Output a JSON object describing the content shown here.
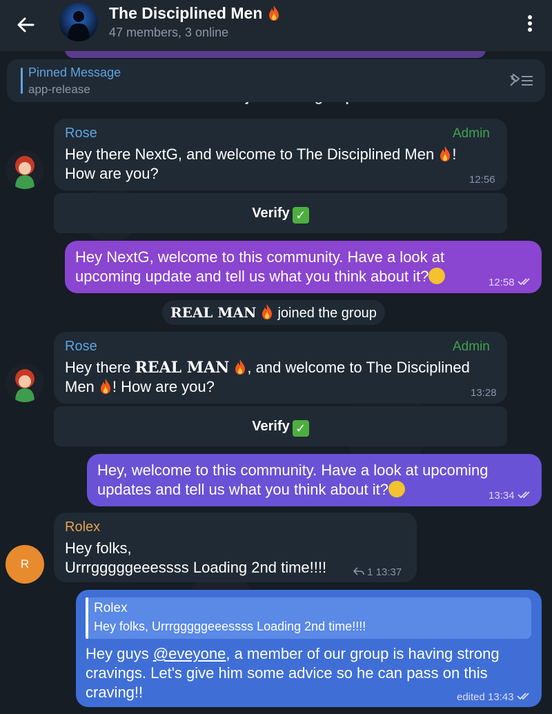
{
  "header": {
    "title": "The Disciplined Men",
    "subtitle": "47 members, 3 online"
  },
  "pinned": {
    "label": "Pinned Message",
    "text": "app-release"
  },
  "clipped_service": "NextG joined the group",
  "messages": [
    {
      "sender": "Rose",
      "role": "Admin",
      "line1": "Hey there NextG, and welcome to The Disciplined Men",
      "line1_end": "!",
      "line2": "How are you?",
      "time": "12:56",
      "button": "Verify"
    },
    {
      "line1": "Hey NextG, welcome to this community. Have a look at",
      "line2": "upcoming update and tell us what you think about it?",
      "time": "12:58"
    },
    {
      "service_name": "REAL MAN",
      "service_text": "joined the group"
    },
    {
      "sender": "Rose",
      "role": "Admin",
      "line1_a": "Hey there",
      "line1_name": "REAL MAN",
      "line1_b": ", and welcome to The Disciplined",
      "line2_a": "Men",
      "line2_b": "! How are you?",
      "time": "13:28",
      "button": "Verify"
    },
    {
      "line1": "Hey, welcome to this community. Have a look at upcoming",
      "line2": "updates and tell us what you think about it?",
      "time": "13:34"
    },
    {
      "sender": "Rolex",
      "avatar_letter": "R",
      "line1": "Hey folks,",
      "line2": "Urrrgggggeeessss Loading 2nd time!!!!",
      "reply_count": "1",
      "time": "13:37"
    },
    {
      "reply_to_name": "Rolex",
      "reply_to_text": "Hey folks, Urrrgggggeeessss Loading 2nd time!!!!",
      "line1_a": "Hey guys",
      "mention": "@eveyone",
      "line1_b": ", a member of our group is having strong",
      "line2": "cravings. Let's give him some advice so he can pass on this",
      "line3": "craving!!",
      "status": "edited",
      "time": "13:43"
    }
  ],
  "colors": {
    "header_bg": "#1f2731",
    "incoming_bubble": "#202a35",
    "outgoing_purple": "#8a45d1",
    "outgoing_blue": "#3f6fd6",
    "admin_green": "#3fa24a",
    "rose_name": "#5ea4e0",
    "rolex_name": "#e7a14a"
  },
  "icons": [
    "back-arrow-icon",
    "more-vertical-icon",
    "unpin-list-icon",
    "fire-emoji",
    "check-emoji",
    "thinking-emoji",
    "double-check-icon",
    "reply-arrow-icon"
  ]
}
